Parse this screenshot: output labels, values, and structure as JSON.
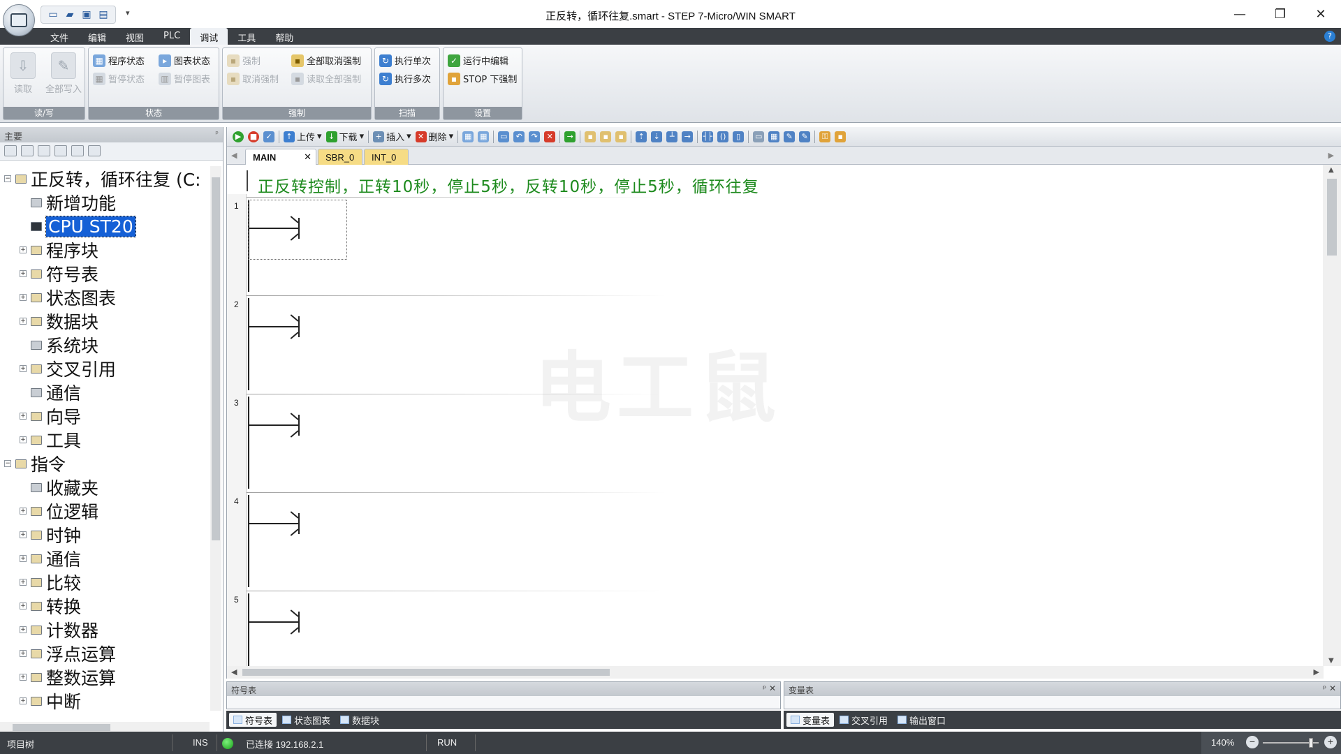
{
  "window": {
    "title": "正反转，循环往复.smart - STEP 7-Micro/WIN SMART",
    "controls": {
      "minimize": "—",
      "restore": "❐",
      "close": "✕"
    }
  },
  "quick_access": {
    "more": "▾"
  },
  "menu": {
    "items": [
      "文件",
      "编辑",
      "视图",
      "PLC",
      "调试",
      "工具",
      "帮助"
    ],
    "active": "调试",
    "help": "?"
  },
  "ribbon": {
    "groups": {
      "readwrite": {
        "label": "读/写",
        "read": "读取",
        "write_all": "全部写入"
      },
      "status": {
        "label": "状态",
        "program_status": "程序状态",
        "chart_status": "图表状态",
        "pause_status": "暂停状态",
        "pause_chart": "暂停图表"
      },
      "force": {
        "label": "强制",
        "force": "强制",
        "unforce": "取消强制",
        "unforce_all": "全部取消强制",
        "read_all_forced": "读取全部强制"
      },
      "scan": {
        "label": "扫描",
        "single": "执行单次",
        "multiple": "执行多次"
      },
      "settings": {
        "label": "设置",
        "run_edit": "运行中编辑",
        "stop_force": "STOP 下强制"
      }
    }
  },
  "left_panel": {
    "title": "主要",
    "pin": "ᵖ",
    "tree": [
      {
        "label": "正反转，循环往复 (C:",
        "level": 0,
        "expander": "−"
      },
      {
        "label": "新增功能",
        "level": 1,
        "expander": ""
      },
      {
        "label": "CPU ST20",
        "level": 1,
        "expander": "",
        "selected": true
      },
      {
        "label": "程序块",
        "level": 1,
        "expander": "+"
      },
      {
        "label": "符号表",
        "level": 1,
        "expander": "+"
      },
      {
        "label": "状态图表",
        "level": 1,
        "expander": "+"
      },
      {
        "label": "数据块",
        "level": 1,
        "expander": "+"
      },
      {
        "label": "系统块",
        "level": 1,
        "expander": ""
      },
      {
        "label": "交叉引用",
        "level": 1,
        "expander": "+"
      },
      {
        "label": "通信",
        "level": 1,
        "expander": ""
      },
      {
        "label": "向导",
        "level": 1,
        "expander": "+"
      },
      {
        "label": "工具",
        "level": 1,
        "expander": "+"
      },
      {
        "label": "指令",
        "level": 0,
        "expander": "−"
      },
      {
        "label": "收藏夹",
        "level": 1,
        "expander": ""
      },
      {
        "label": "位逻辑",
        "level": 1,
        "expander": "+"
      },
      {
        "label": "时钟",
        "level": 1,
        "expander": "+"
      },
      {
        "label": "通信",
        "level": 1,
        "expander": "+"
      },
      {
        "label": "比较",
        "level": 1,
        "expander": "+"
      },
      {
        "label": "转换",
        "level": 1,
        "expander": "+"
      },
      {
        "label": "计数器",
        "level": 1,
        "expander": "+"
      },
      {
        "label": "浮点运算",
        "level": 1,
        "expander": "+"
      },
      {
        "label": "整数运算",
        "level": 1,
        "expander": "+"
      },
      {
        "label": "中断",
        "level": 1,
        "expander": "+"
      }
    ]
  },
  "editor_toolbar": {
    "upload": "上传",
    "download": "下载",
    "insert": "插入",
    "delete": "删除"
  },
  "tabs": {
    "main": "MAIN",
    "close": "✕",
    "sbr": "SBR_0",
    "int": "INT_0"
  },
  "program": {
    "comment": "正反转控制，正转10秒，停止5秒，反转10秒，停止5秒，循环往复",
    "networks": [
      "1",
      "2",
      "3",
      "4",
      "5"
    ],
    "watermark": "电工鼠"
  },
  "bottom": {
    "symbol_pane_title": "符号表",
    "var_pane_title": "变量表",
    "pane_controls": "ᵖ ✕",
    "left_tabs": [
      "符号表",
      "状态图表",
      "数据块"
    ],
    "right_tabs": [
      "变量表",
      "交叉引用",
      "输出窗口"
    ]
  },
  "status": {
    "project_tree": "项目树",
    "ins": "INS",
    "connected": "已连接 192.168.2.1",
    "run": "RUN",
    "zoom": "140%",
    "zoom_minus": "−",
    "zoom_plus": "+"
  }
}
